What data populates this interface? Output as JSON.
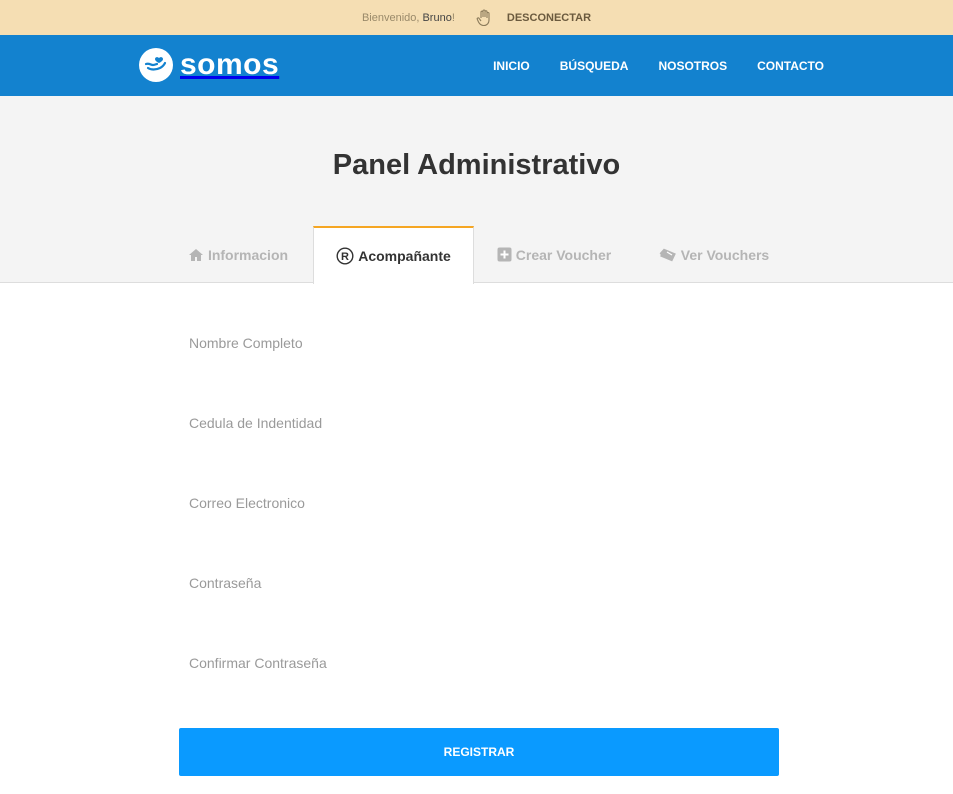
{
  "topbar": {
    "welcome": "Bienvenido,",
    "user": "Bruno",
    "suffix": " !",
    "logout_label": "DESCONECTAR"
  },
  "brand": {
    "name": "somos",
    "color": "#1382cf"
  },
  "nav": {
    "items": [
      {
        "label": "INICIO"
      },
      {
        "label": "BÚSQUEDA"
      },
      {
        "label": "NOSOTROS"
      },
      {
        "label": "CONTACTO"
      }
    ]
  },
  "page": {
    "title": "Panel Administrativo"
  },
  "tabs": [
    {
      "label": "Informacion",
      "icon": "home-icon",
      "active": false
    },
    {
      "label": "Acompañante",
      "icon": "registered-icon",
      "active": true
    },
    {
      "label": "Crear Voucher",
      "icon": "plus-square-icon",
      "active": false
    },
    {
      "label": "Ver Vouchers",
      "icon": "ticket-icon",
      "active": false
    }
  ],
  "form": {
    "fields": [
      {
        "placeholder": "Nombre Completo",
        "value": ""
      },
      {
        "placeholder": "Cedula de Indentidad",
        "value": ""
      },
      {
        "placeholder": "Correo Electronico",
        "value": ""
      },
      {
        "placeholder": "Contraseña",
        "value": ""
      },
      {
        "placeholder": "Confirmar Contraseña",
        "value": ""
      }
    ],
    "submit_label": "REGISTRAR"
  },
  "colors": {
    "topbar_bg": "#f5deb3",
    "nav_bg": "#1382cf",
    "active_tab_border": "#f5a623",
    "button_bg": "#0a9aff"
  }
}
